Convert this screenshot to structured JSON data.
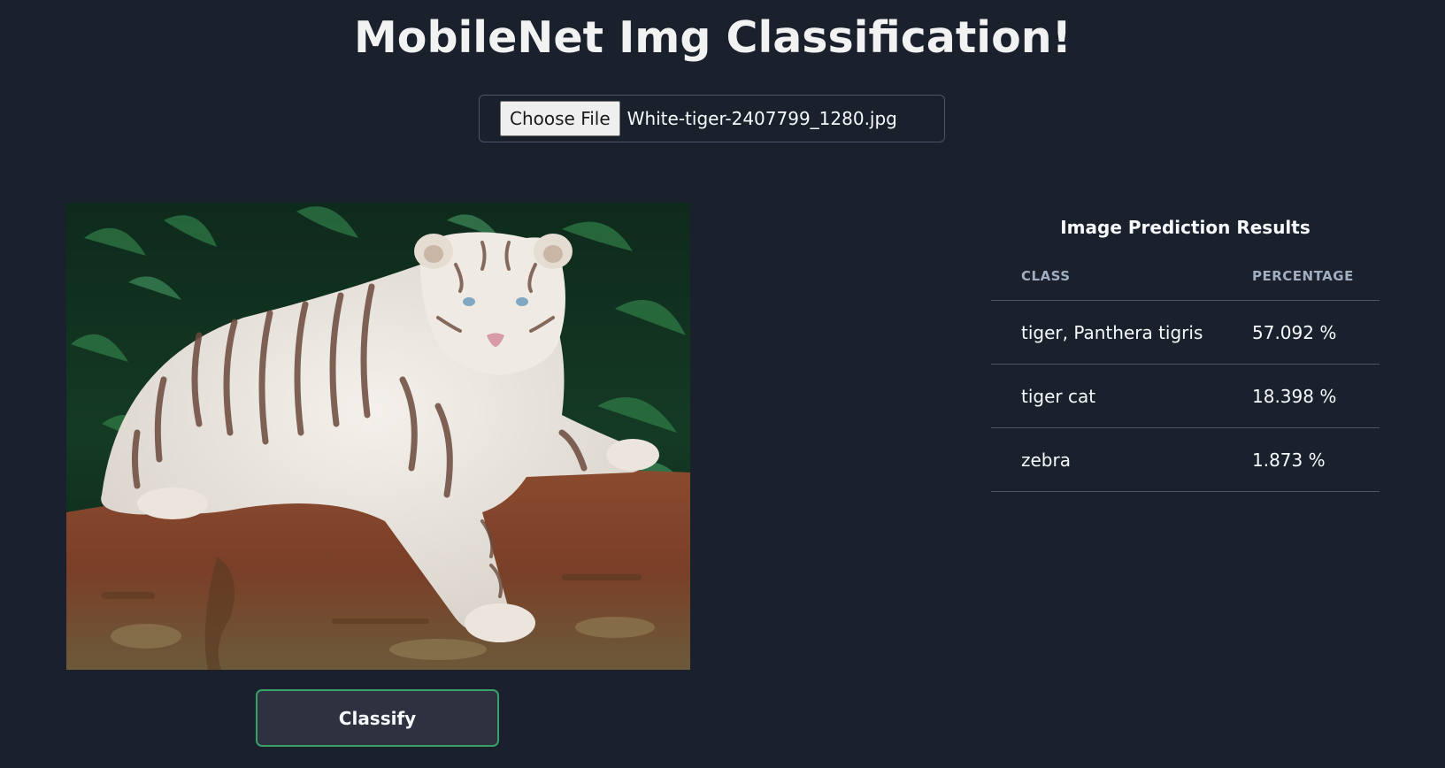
{
  "header": {
    "title": "MobileNet Img Classification!"
  },
  "file_input": {
    "button_label": "Choose File",
    "file_name": "White-tiger-2407799_1280.jpg"
  },
  "preview": {
    "subject": "white tiger lying on a log"
  },
  "actions": {
    "classify_label": "Classify"
  },
  "results": {
    "caption": "Image Prediction Results",
    "columns": [
      "CLASS",
      "PERCENTAGE"
    ],
    "rows": [
      {
        "class": "tiger, Panthera tigris",
        "percentage": "57.092 %"
      },
      {
        "class": "tiger cat",
        "percentage": "18.398 %"
      },
      {
        "class": "zebra",
        "percentage": "1.873 %"
      }
    ]
  },
  "colors": {
    "background": "#1a202c",
    "accent_border": "#38a169",
    "table_header": "#a0aec0",
    "divider": "#4a5568"
  }
}
